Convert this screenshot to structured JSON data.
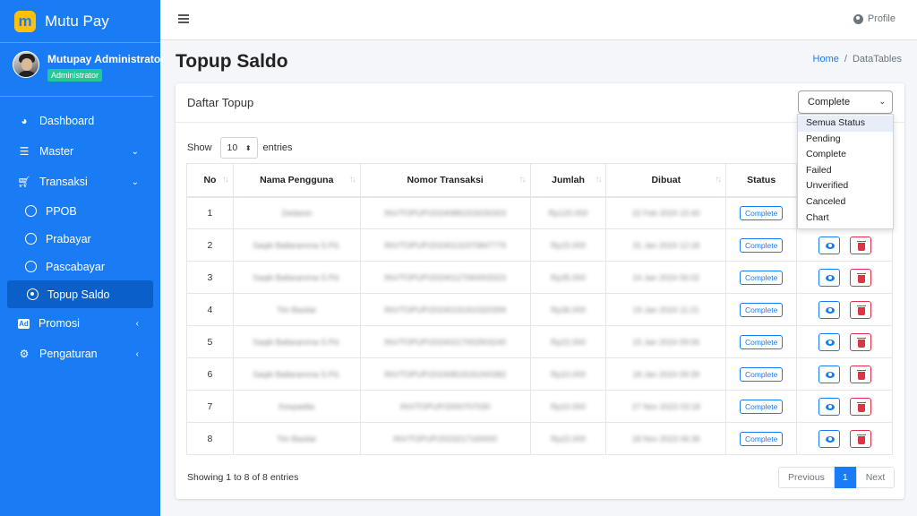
{
  "brand": {
    "name": "Mutu Pay",
    "logo_letter": "m"
  },
  "user": {
    "name": "Mutupay Administrator",
    "role": "Administrator"
  },
  "nav": {
    "dashboard": "Dashboard",
    "master": "Master",
    "transaksi": "Transaksi",
    "ppob": "PPOB",
    "prabayar": "Prabayar",
    "pascabayar": "Pascabayar",
    "topup_saldo": "Topup Saldo",
    "promosi": "Promosi",
    "pengaturan": "Pengaturan"
  },
  "topbar": {
    "profile": "Profile"
  },
  "page": {
    "title": "Topup Saldo"
  },
  "breadcrumb": {
    "home": "Home",
    "separator": "/",
    "current": "DataTables"
  },
  "card": {
    "title": "Daftar Topup",
    "status_selected": "Complete",
    "status_options": [
      "Semua Status",
      "Pending",
      "Complete",
      "Failed",
      "Unverified",
      "Canceled",
      "Chart"
    ]
  },
  "entries": {
    "show": "Show",
    "value": "10",
    "suffix": "entries"
  },
  "table": {
    "headers": [
      "No",
      "Nama Pengguna",
      "Nomor Transaksi",
      "Jumlah",
      "Dibuat",
      "Status",
      ""
    ],
    "rows": [
      {
        "no": "1",
        "name": "Zeidanin",
        "trx": "INV/TOPUP/20240881915030303",
        "amount": "Rp120.000",
        "date": "22 Feb 2024 15:40",
        "status": "Complete"
      },
      {
        "no": "2",
        "name": "Saqib Ballaramma S.Pd.",
        "trx": "INV/TOPUP/20240131970847779",
        "amount": "Rp15.000",
        "date": "31 Jan 2024 12:18",
        "status": "Complete"
      },
      {
        "no": "3",
        "name": "Saqib Ballaramma S.Pd.",
        "trx": "INV/TOPUP/20240127060003323",
        "amount": "Rp35.000",
        "date": "24 Jan 2024 06:02",
        "status": "Complete"
      },
      {
        "no": "4",
        "name": "Tiin Basilar",
        "trx": "INV/TOPUP/20240191910320399",
        "amount": "Rp36.000",
        "date": "19 Jan 2024 11:21",
        "status": "Complete"
      },
      {
        "no": "5",
        "name": "Saqib Ballaramma S.Pd.",
        "trx": "INV/TOPUP/20240217002903240",
        "amount": "Rp22.000",
        "date": "15 Jan 2024 09:06",
        "status": "Complete"
      },
      {
        "no": "6",
        "name": "Saqib Ballaramma S.Pd.",
        "trx": "INV/TOPUP/20240819191000382",
        "amount": "Rp10.000",
        "date": "18 Jan 2024 09:39",
        "status": "Complete"
      },
      {
        "no": "7",
        "name": "Kespadila",
        "trx": "INV/TOPUP/2000707030",
        "amount": "Rp10.000",
        "date": "27 Nov 2023 03:18",
        "status": "Complete"
      },
      {
        "no": "8",
        "name": "Tiin Basilar",
        "trx": "INV/TOPUP/2023217160000",
        "amount": "Rp22.000",
        "date": "18 Nov 2023 06:36",
        "status": "Complete"
      }
    ]
  },
  "footer": {
    "info": "Showing 1 to 8 of 8 entries"
  },
  "pagination": {
    "previous": "Previous",
    "current": "1",
    "next": "Next"
  },
  "colors": {
    "primary": "#1a7cf5",
    "sidebar": "#1a7cf5",
    "danger": "#dc3545",
    "role_badge": "#20c997",
    "logo": "#ffc107"
  }
}
